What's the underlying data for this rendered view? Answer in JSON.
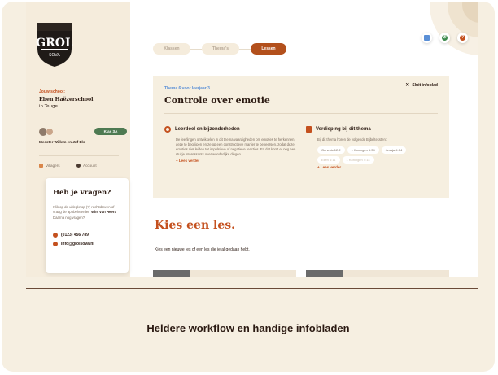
{
  "sidebar": {
    "logo_text": "GROL",
    "logo_sub": "SOVA",
    "school_label": "Jouw school:",
    "school_name_line1": "Eben Haëzerschool",
    "school_name_line2": "in Teuge",
    "class_badge": "Klas 3A",
    "teachers": "Meester Willem en Juf Els",
    "links": [
      "Villagers",
      "Account"
    ],
    "help": {
      "title": "Heb je vragen?",
      "text_pre": "Klik op de uitlegknop (?) rechtsboven of vraag de appbeheerder:",
      "text_name": "Wim van Heert",
      "text_post": ". Daarna nog vragen?",
      "phone": "(0123) 456 789",
      "email": "info@grolsova.nl"
    }
  },
  "stepper": [
    "Klassen",
    "Thema's",
    "Lessen"
  ],
  "top_icons": [
    "document-icon",
    "whatsapp-icon",
    "help-icon"
  ],
  "panel": {
    "subtitle": "Thema 6 voor leerjaar 3",
    "title": "Controle over emotie",
    "close_label": "Sluit infoblad",
    "left": {
      "heading": "Leerdoel en bijzonderheden",
      "text": "De leerlingen ontwikkelen in dit thema vaardigheden om emoties te herkennen, deze te begrijpen en ze op een constructieve manier te beheersen, zodat deze emoties niet leiden tot impulsieve of negatieve reacties. En dat komt er nog een stukje interessants over wonderlijke dingen...",
      "more": "+ Lees verder"
    },
    "right": {
      "heading": "Verdieping bij dit thema",
      "text": "Bij dit thema horen de volgende Bijbelteksten:",
      "chips": [
        "Genesis 12:2",
        "1 Koningen 6:34",
        "Jesaja 4:14",
        "Ellen 6:11",
        "1 Koningen 4:14"
      ],
      "more": "+ Lees verder"
    }
  },
  "lessons": {
    "title": "Kies een les.",
    "subtitle": "Kies een nieuwe les of een les die je al gedaan hebt."
  },
  "caption": "Heldere workflow en handige infobladen",
  "colors": {
    "accent": "#c4501e",
    "panel_bg": "#f6efe0",
    "sidebar_bg": "#f5ecdc",
    "badge": "#4e7a52"
  }
}
